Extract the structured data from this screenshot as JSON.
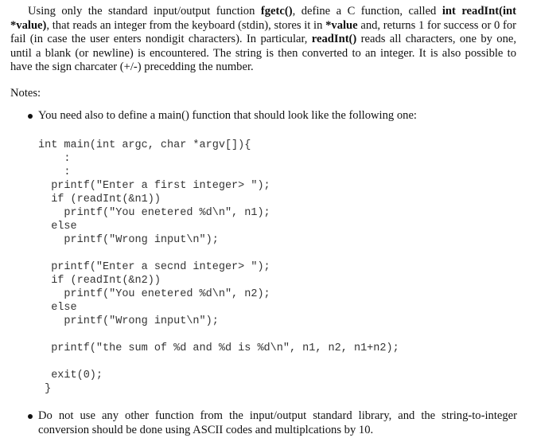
{
  "intro": {
    "t1": "Using only the standard input/output function ",
    "b1": "fgetc()",
    "t2": ", define a C function, called ",
    "b2": "int readInt(int *value)",
    "t3": ", that reads an integer from the keyboard (stdin), stores it in ",
    "b3": "*value",
    "t4": " and, returns 1 for success or 0 for fail (in case the user enters nondigit characters). In particular, ",
    "b4": "readInt()",
    "t5": " reads all characters, one by one, until a blank (or newline) is encountered. The string is then converted to an integer. It is also possible to have the sign charcater (+/-) precedding the number."
  },
  "notes_label": "Notes:",
  "bullets": [
    "You need also to define a main() function that should look like the following one:",
    "Do not use any other function from the input/output standard library, and the string-to-integer conversion should be done using ASCII codes and multiplcations by 10."
  ],
  "code": [
    "int main(int argc, char *argv[]){",
    "    :",
    "    :",
    "  printf(\"Enter a first integer> \");",
    "  if (readInt(&n1))",
    "    printf(\"You enetered %d\\n\", n1);",
    "  else",
    "    printf(\"Wrong input\\n\");",
    "",
    "  printf(\"Enter a secnd integer> \");",
    "  if (readInt(&n2))",
    "    printf(\"You enetered %d\\n\", n2);",
    "  else",
    "    printf(\"Wrong input\\n\");",
    "",
    "  printf(\"the sum of %d and %d is %d\\n\", n1, n2, n1+n2);",
    "",
    "  exit(0);",
    " }"
  ]
}
